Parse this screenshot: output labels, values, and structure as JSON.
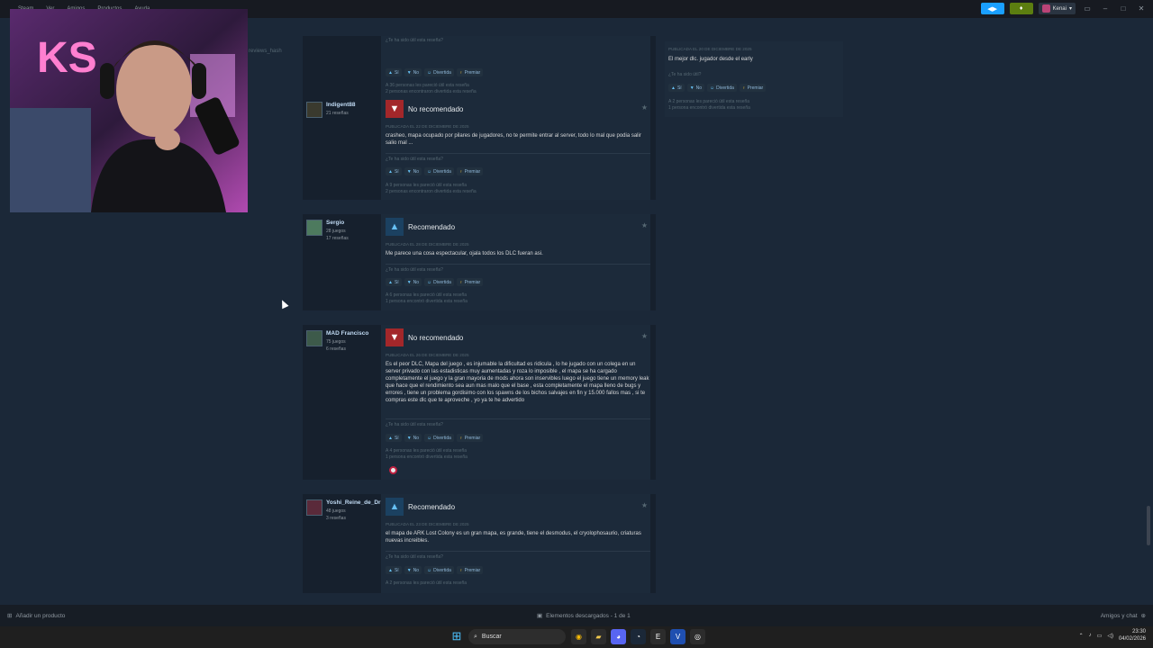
{
  "titlebar": {
    "menu": [
      "Steam",
      "Ver",
      "Amigos",
      "Productos",
      "Ayuda"
    ],
    "username": "Kenai",
    "subnav": "reviews_hash"
  },
  "partial_top_card": {
    "helpful_q": "¿Te ha sido útil esta reseña?",
    "counts": [
      "A 36 personas les pareció útil esta reseña",
      "2 personas encontraron divertida esta reseña"
    ]
  },
  "buttons": {
    "yes": "Sí",
    "no": "No",
    "funny": "Divertida",
    "award": "Premiar"
  },
  "reviews": [
    {
      "author": "Indigent88",
      "stats": [
        "21 reseñas"
      ],
      "verdict": "No recomendado",
      "posted": "Publicada el 22 de diciembre de 2025",
      "text": "crasheo, mapa ocupado por pilares de jugadores, no te permite entrar al server, todo lo mal que podia salir salio mal ...",
      "helpful_q": "¿Te ha sido útil esta reseña?",
      "counts": [
        "A 9 personas les pareció útil esta reseña",
        "2 personas encontraron divertida esta reseña"
      ]
    },
    {
      "author": "Sergio",
      "stats": [
        "28 juegos",
        "17 reseñas"
      ],
      "verdict": "Recomendado",
      "posted": "Publicada el 28 de diciembre de 2025",
      "text": "Me parece una cosa espectacular, ojala todos los DLC fueran asi.",
      "helpful_q": "¿Te ha sido útil esta reseña?",
      "counts": [
        "A 6 personas les pareció útil esta reseña",
        "1 persona encontró divertida esta reseña"
      ]
    },
    {
      "author": "MAD Francisco",
      "stats": [
        "75 juegos",
        "6 reseñas"
      ],
      "verdict": "No recomendado",
      "posted": "Publicada el 26 de diciembre de 2025",
      "text": "Es el peor DLC, Mapa del juego , es injumable la dificultad es ridicula , lo he jugado con un colega en un server privado con las estadisticas muy aumentadas y roza lo imposible , el mapa se ha cargado completamente el juego y la gran mayoria de mods ahora son inservibles luego el juego tiene un memory leak que hace que el rendimiento sea aun mas malo que el base , esta completamente el mapa lleno de bugs y errores , tiene un problema gordisimo con los spawns de los bichos salvajes en fin y 15.000 fallos mas , si te compras este dlc que te aproveche , yo ya te he advertido",
      "helpful_q": "¿Te ha sido útil esta reseña?",
      "counts": [
        "A 4 personas les pareció útil esta reseña",
        "1 persona encontró divertida esta reseña"
      ]
    },
    {
      "author": "Yoshi_Reine_de_Dr",
      "stats": [
        "48 juegos",
        "3 reseñas"
      ],
      "verdict": "Recomendado",
      "posted": "Publicada el 23 de diciembre de 2025",
      "text": "el mapa de ARK Lost Colony es un gran mapa, es grande, tiene el desmodus, el cryolophosaurio, criaturas nuevas increibles.",
      "helpful_q": "¿Te ha sido útil esta reseña?",
      "counts": [
        "A 2 personas les pareció útil esta reseña"
      ]
    }
  ],
  "right_panel": {
    "posted": "Publicada el 20 de diciembre de 2025",
    "text": "El mejor dlc. jugador desde el early",
    "helpful_q": "¿Te ha sido útil?",
    "counts": [
      "A 2 personas les pareció útil esta reseña",
      "1 persona encontró divertida esta reseña"
    ]
  },
  "bottombar": {
    "add_product": "Añadir un producto",
    "downloads": "Elementos descargados - 1 de 1",
    "friends": "Amigos y chat"
  },
  "taskbar": {
    "search": "Buscar",
    "time": "23:30",
    "date": "04/02/2026"
  }
}
